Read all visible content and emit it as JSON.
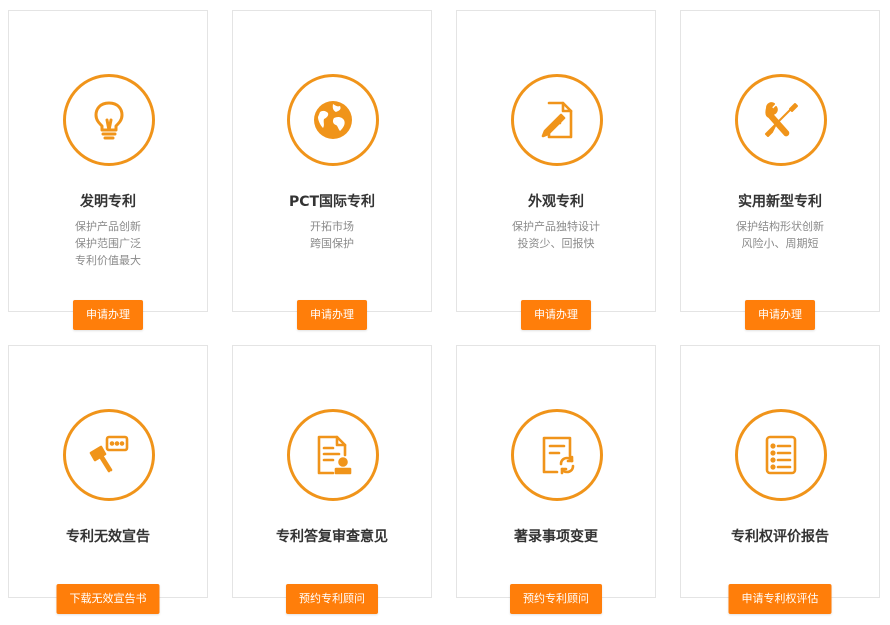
{
  "cards": [
    {
      "title": "发明专利",
      "desc": [
        "保护产品创新",
        "保护范围广泛",
        "专利价值最大"
      ],
      "button": "申请办理",
      "icon": "lightbulb-icon"
    },
    {
      "title": "PCT国际专利",
      "desc": [
        "开拓市场",
        "跨国保护"
      ],
      "button": "申请办理",
      "icon": "globe-icon"
    },
    {
      "title": "外观专利",
      "desc": [
        "保护产品独特设计",
        "投资少、回报快"
      ],
      "button": "申请办理",
      "icon": "paint-brush-document-icon"
    },
    {
      "title": "实用新型专利",
      "desc": [
        "保护结构形状创新",
        "风险小、周期短"
      ],
      "button": "申请办理",
      "icon": "wrench-screwdriver-icon"
    },
    {
      "title": "专利无效宣告",
      "desc": [],
      "button": "下载无效宣告书",
      "icon": "gavel-chat-icon"
    },
    {
      "title": "专利答复审查意见",
      "desc": [],
      "button": "预约专利顾问",
      "icon": "document-stamp-icon"
    },
    {
      "title": "著录事项变更",
      "desc": [],
      "button": "预约专利顾问",
      "icon": "document-refresh-icon"
    },
    {
      "title": "专利权评价报告",
      "desc": [],
      "button": "申请专利权评估",
      "icon": "checklist-report-icon"
    }
  ],
  "colors": {
    "accent": "#f0941a",
    "button": "#ff7e0a",
    "title": "#333333",
    "desc": "#8a8a8a"
  }
}
